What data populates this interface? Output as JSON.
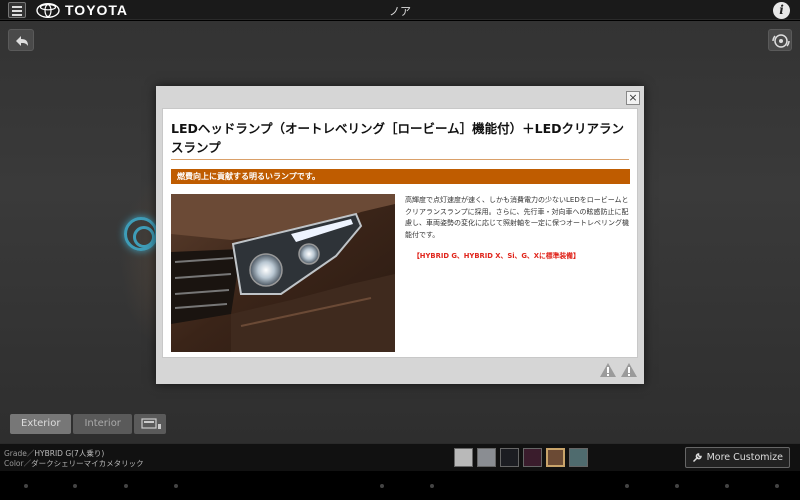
{
  "header": {
    "brand": "TOYOTA",
    "title": "ノア",
    "menu_icon": "hamburger-icon",
    "info_icon": "info-icon",
    "info_label": "i"
  },
  "viewer": {
    "back_icon": "back-arrow-icon",
    "rotate_icon": "rotate-icon",
    "tabs": [
      {
        "label": "Exterior",
        "active": true
      },
      {
        "label": "Interior",
        "active": false
      }
    ],
    "view_mode_icon": "car-view-icon"
  },
  "bottom": {
    "grade_label": "Grade／",
    "grade_value": "HYBRID G(7人乗り)",
    "color_label": "Color／",
    "color_value": "ダークシェリーマイカメタリック",
    "swatches": [
      "#b9b9b9",
      "#8a8d92",
      "#1c1d22",
      "#3a1c2c",
      "#6b4a34",
      "#4f6b6e"
    ],
    "selected_swatch": 4,
    "more_customize": "More Customize"
  },
  "modal": {
    "close_label": "×",
    "title": "LEDヘッドランプ（オートレベリング［ロービーム］機能付）＋LEDクリアランスランプ",
    "subtitle": "燃費向上に貢献する明るいランプです。",
    "description": "高輝度で点灯速度が速く、しかも消費電力の少ないLEDをロービームとクリアランスランプに採用。さらに、先行車・対向車への眩惑防止に配慮し、車両姿勢の変化に応じて照射軸を一定に保つオートレベリング機能付です。",
    "grades_note": "【HYBRID G、HYBRID X、Si、G、Xに標準装備】",
    "accent_color": "#bf5c00",
    "warning_icons": [
      "warning-icon",
      "warning-icon"
    ]
  }
}
